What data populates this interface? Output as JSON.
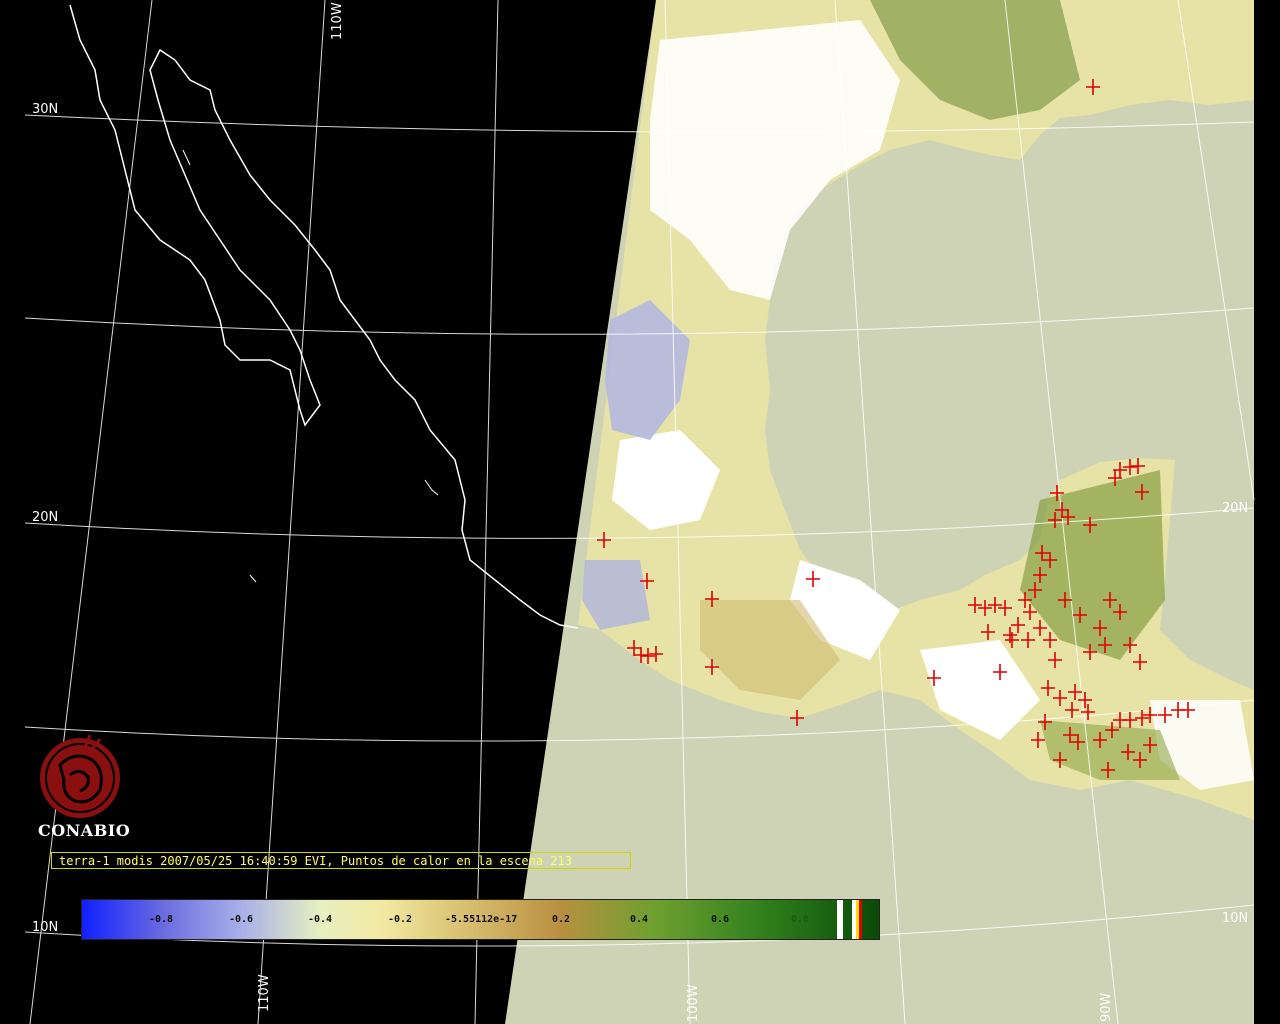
{
  "grid_labels": {
    "lat_30": "30N",
    "lat_20_left": "20N",
    "lat_20_right": "20N",
    "lat_10_left": "10N",
    "lat_10_right": "10N",
    "lon_110_top": "110W",
    "lon_110_bottom": "110W",
    "lon_100": "100W",
    "lon_90": "90W"
  },
  "logo": {
    "name": "CONABIO"
  },
  "caption": "terra-1 modis 2007/05/25 16:40:59 EVI, Puntos de calor en la escena 213",
  "colorbar": {
    "ticks": [
      "-0.8",
      "-0.6",
      "-0.4",
      "-0.2",
      "-5.55112e-17",
      "0.2",
      "0.4",
      "0.6",
      "0.8"
    ]
  },
  "colors": {
    "ocean": "#cdd3b4",
    "night": "#000000",
    "coast_night": "#ffffff",
    "hotspot": "#e00000",
    "caption_text": "#ffff66"
  },
  "hotspots_count_label": "213"
}
